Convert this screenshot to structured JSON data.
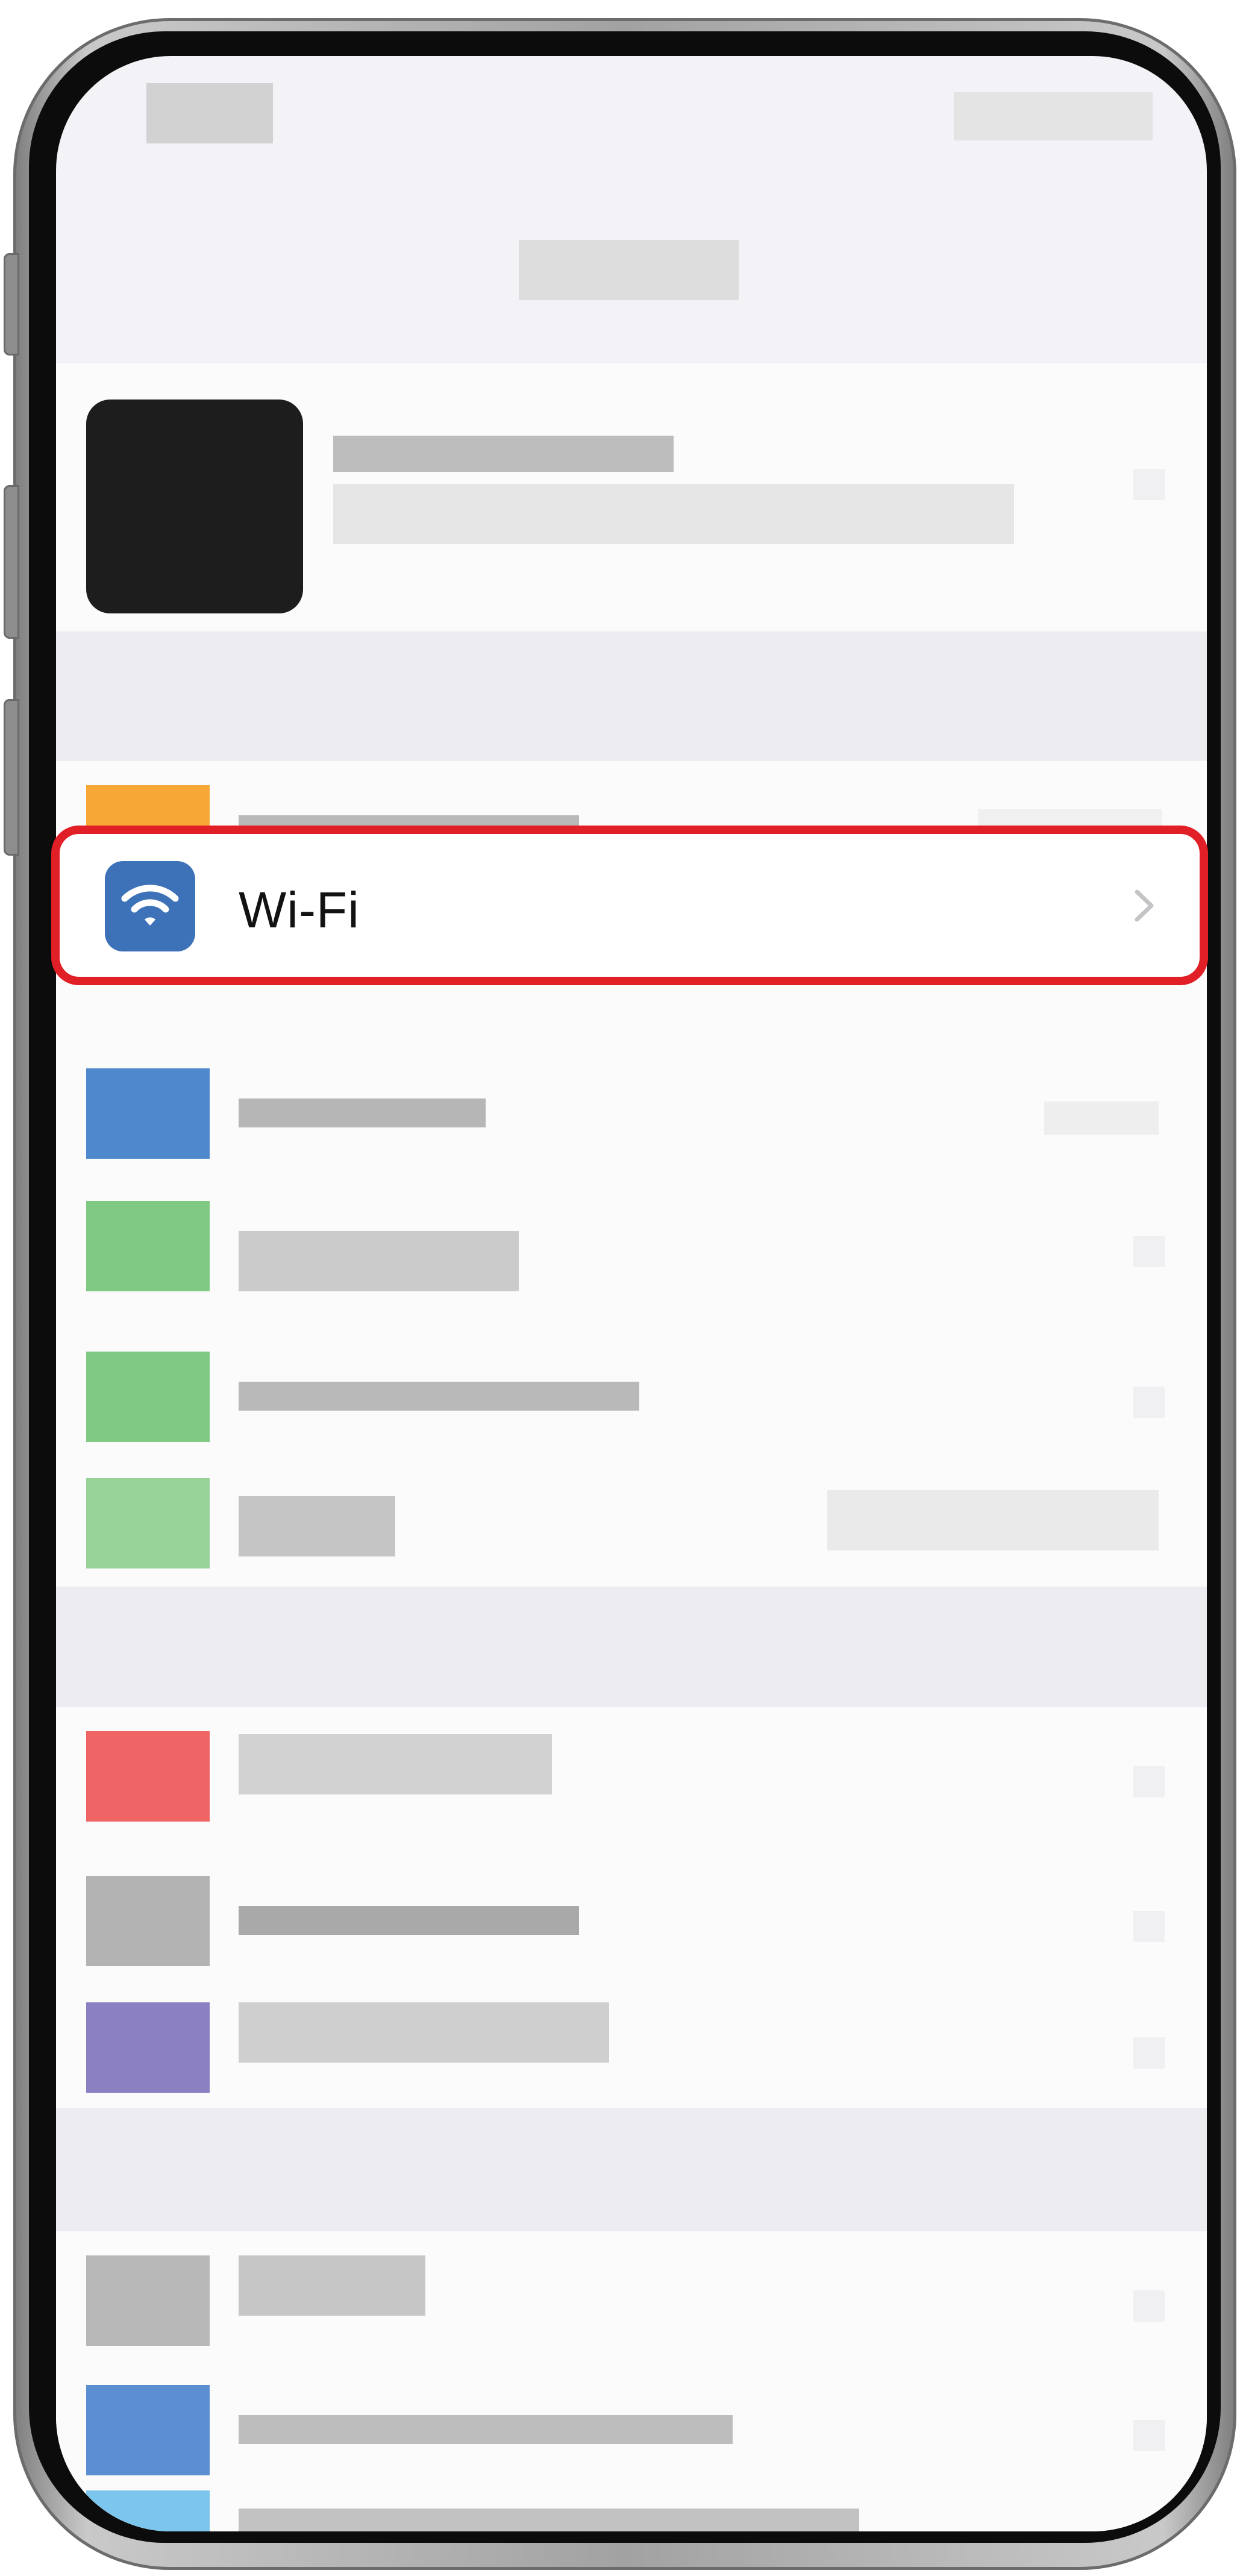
{
  "settings_list": {
    "wifi_row": {
      "label": "Wi-Fi",
      "icon": "wifi-icon",
      "icon_color": "#3d72b8",
      "chevron": "chevron-right-icon"
    }
  },
  "highlight": {
    "color": "#e01f26"
  },
  "icons": {
    "row_icon_colors": [
      "#f7a736",
      "#3d72b8",
      "#5cb960",
      "#5cb960",
      "#5cb960",
      "#ef5454",
      "#9a9a9a",
      "#7467b0",
      "#a2a2a2",
      "#4f88cc",
      "#67bfe8"
    ]
  }
}
